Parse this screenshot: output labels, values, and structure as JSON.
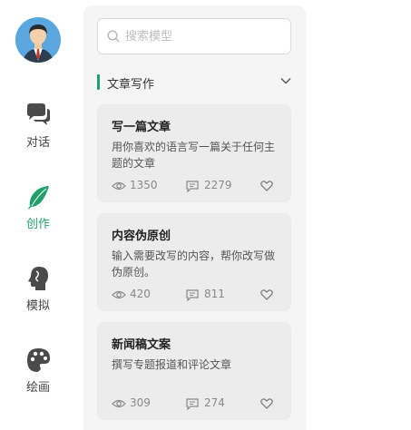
{
  "nav": {
    "items": [
      {
        "label": "对话",
        "icon": "chat-icon",
        "active": false
      },
      {
        "label": "创作",
        "icon": "feather-icon",
        "active": true
      },
      {
        "label": "模拟",
        "icon": "head-icon",
        "active": false
      },
      {
        "label": "绘画",
        "icon": "palette-icon",
        "active": false
      }
    ]
  },
  "search": {
    "placeholder": "搜索模型",
    "value": ""
  },
  "section": {
    "title": "文章写作",
    "expanded": true
  },
  "cards": [
    {
      "title": "写一篇文章",
      "desc": "用你喜欢的语言写一篇关于任何主题的文章",
      "views": "1350",
      "comments": "2279"
    },
    {
      "title": "内容伪原创",
      "desc": "输入需要改写的内容，帮你改写做伪原创。",
      "views": "420",
      "comments": "811"
    },
    {
      "title": "新闻稿文案",
      "desc": "撰写专题报道和评论文章",
      "views": "309",
      "comments": "274"
    }
  ],
  "colors": {
    "accent": "#22a06b",
    "panel_bg": "#f5f5f5",
    "card_bg": "#ececec"
  }
}
